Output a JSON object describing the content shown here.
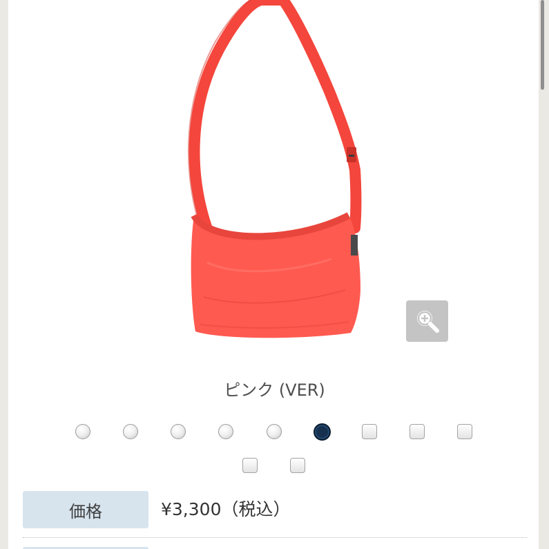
{
  "product": {
    "variant_name": "ピンク (VER)",
    "main_color": "#ff5a50",
    "strap_color": "#f4463c"
  },
  "zoom": {
    "icon": "zoom-in-icon"
  },
  "swatches": [
    {
      "shape": "round",
      "selected": false
    },
    {
      "shape": "round",
      "selected": false
    },
    {
      "shape": "round",
      "selected": false
    },
    {
      "shape": "round",
      "selected": false
    },
    {
      "shape": "round",
      "selected": false
    },
    {
      "shape": "round",
      "selected": true,
      "color": "#16314f"
    },
    {
      "shape": "square",
      "selected": false
    },
    {
      "shape": "square",
      "selected": false
    },
    {
      "shape": "square",
      "selected": false
    },
    {
      "shape": "square",
      "selected": false
    },
    {
      "shape": "square",
      "selected": false
    }
  ],
  "price": {
    "label": "価格",
    "value": "¥3,300（税込）"
  },
  "colors": {
    "label_bg": "#d7e4ee",
    "zoom_bg": "#c4c4c4"
  }
}
